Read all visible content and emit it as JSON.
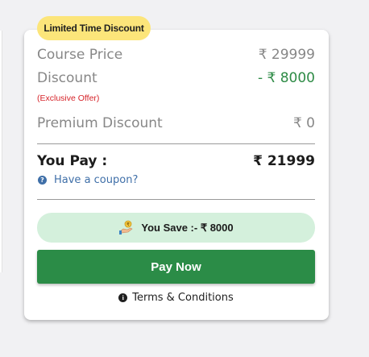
{
  "badge": {
    "label": "Limited Time Discount"
  },
  "pricing": {
    "course_price_label": "Course Price",
    "course_price_value": "₹ 29999",
    "discount_label": "Discount",
    "discount_value": "- ₹ 8000",
    "exclusive_offer_note": "(Exclusive Offer)",
    "premium_discount_label": "Premium Discount",
    "premium_discount_value": "₹ 0"
  },
  "total": {
    "label": "You Pay :",
    "value": "₹ 21999"
  },
  "coupon": {
    "label": "Have a coupon?",
    "icon": "question-icon"
  },
  "savings": {
    "label": "You Save :- ₹ 8000",
    "icon": "money-hand-icon"
  },
  "pay_button": {
    "label": "Pay Now"
  },
  "terms": {
    "label": "Terms & Conditions",
    "icon": "info-icon"
  },
  "colors": {
    "badge_bg": "#fce57a",
    "discount_green": "#2e8b46",
    "offer_red": "#d6242a",
    "link_blue": "#3f6fa8",
    "save_bg": "#d4f0dc",
    "button_green": "#2b8c47"
  }
}
